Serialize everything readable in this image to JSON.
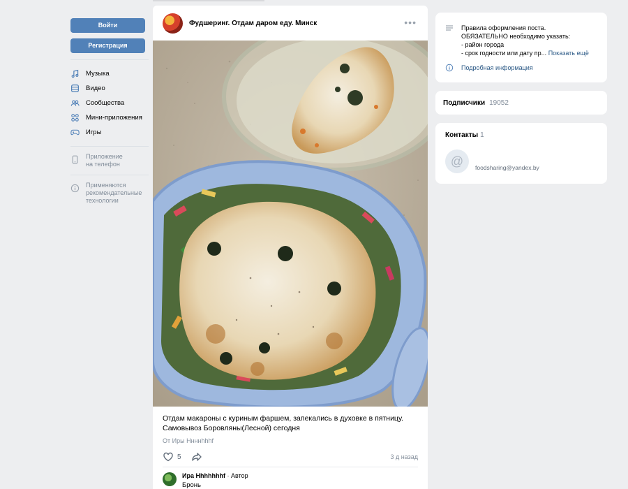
{
  "auth": {
    "login_label": "Войти",
    "register_label": "Регистрация"
  },
  "nav": {
    "items": [
      {
        "label": "Музыка",
        "icon": "music-icon"
      },
      {
        "label": "Видео",
        "icon": "video-icon"
      },
      {
        "label": "Сообщества",
        "icon": "groups-icon"
      },
      {
        "label": "Мини-приложения",
        "icon": "apps-icon"
      },
      {
        "label": "Игры",
        "icon": "games-icon"
      }
    ],
    "phone_app": "Приложение\nна телефон",
    "recommend_tech": "Применяются\nрекомендательные\nтехнологии"
  },
  "post": {
    "group_name": "Фудшеринг. Отдам даром еду. Минск",
    "text": "Отдам макароны с куриным фаршем, запекались в духовке в пятницу. Самовывоз Боровляны(Лесной) сегодня",
    "from": "От Иры Ннннhhhf",
    "likes": "5",
    "time": "3 д назад",
    "comment": {
      "author": "Ира Hhhhhhhf",
      "role": "· Автор",
      "text": "Бронь"
    }
  },
  "rules": {
    "text": "Правила оформления поста.\nОБЯЗАТЕЛЬНО необходимо указать:\n- район города\n- срок годности или дату пр...",
    "show_more": "Показать ещё",
    "info_link": "Подробная информация"
  },
  "subscribers": {
    "label": "Подписчики",
    "count": "19052"
  },
  "contacts": {
    "label": "Контакты",
    "count": "1",
    "email": "foodsharing@yandex.by"
  },
  "colors": {
    "accent": "#5181b8",
    "link": "#2a5885",
    "background": "#edeef0"
  }
}
